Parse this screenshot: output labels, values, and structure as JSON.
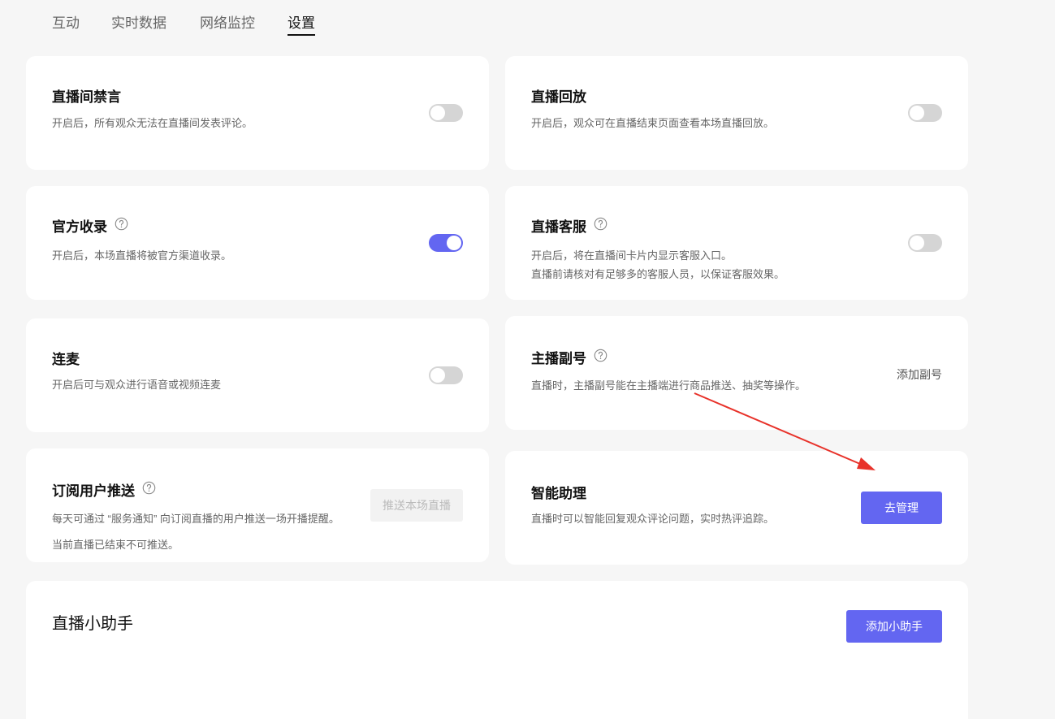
{
  "tabs": [
    {
      "label": "互动",
      "active": false
    },
    {
      "label": "实时数据",
      "active": false
    },
    {
      "label": "网络监控",
      "active": false
    },
    {
      "label": "设置",
      "active": true
    }
  ],
  "cards": {
    "mute": {
      "title": "直播间禁言",
      "desc": "开启后，所有观众无法在直播间发表评论。",
      "enabled": false
    },
    "replay": {
      "title": "直播回放",
      "desc": "开启后，观众可在直播结束页面查看本场直播回放。",
      "enabled": false
    },
    "official": {
      "title": "官方收录",
      "desc": "开启后，本场直播将被官方渠道收录。",
      "enabled": true,
      "help_icon": "question-circle-icon"
    },
    "service": {
      "title": "直播客服",
      "desc": "开启后，将在直播间卡片内显示客服入口。",
      "desc2": "直播前请核对有足够多的客服人员，以保证客服效果。",
      "enabled": false,
      "help_icon": "question-circle-icon"
    },
    "cohost": {
      "title": "连麦",
      "desc": "开启后可与观众进行语音或视频连麦",
      "enabled": false
    },
    "subaccount": {
      "title": "主播副号",
      "desc": "直播时，主播副号能在主播端进行商品推送、抽奖等操作。",
      "action_label": "添加副号",
      "help_icon": "question-circle-icon"
    },
    "subscribe": {
      "title": "订阅用户推送",
      "desc": "每天可通过 “服务通知” 向订阅直播的用户推送一场开播提醒。",
      "desc2": "当前直播已结束不可推送。",
      "button_label": "推送本场直播",
      "button_disabled": true,
      "help_icon": "question-circle-icon"
    },
    "assistant_ai": {
      "title": "智能助理",
      "desc": "直播时可以智能回复观众评论问题，实时热评追踪。",
      "button_label": "去管理"
    },
    "helper": {
      "title": "直播小助手",
      "button_label": "添加小助手"
    }
  },
  "colors": {
    "accent": "#6366f1",
    "toggle_off": "#d5d5d5",
    "annotation_arrow": "#e8322a"
  }
}
